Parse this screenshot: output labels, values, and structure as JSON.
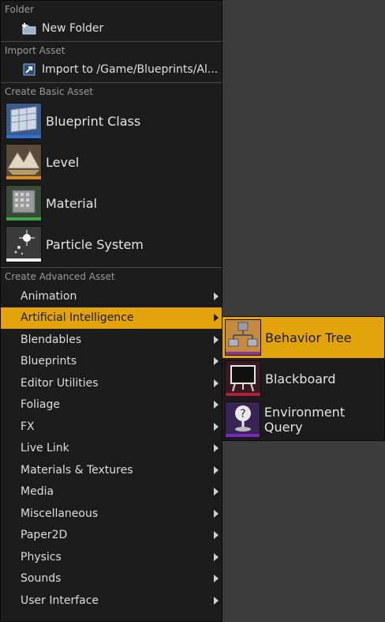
{
  "menu": {
    "folder": {
      "header": "Folder",
      "new_folder": {
        "label": "New Folder",
        "icon": "new-folder-icon"
      }
    },
    "import": {
      "header": "Import Asset",
      "import_item": {
        "label": "Import to /Game/Blueprints/Al...",
        "icon": "import-icon"
      }
    },
    "basic": {
      "header": "Create Basic Asset",
      "items": [
        {
          "label": "Blueprint Class",
          "icon": "blueprint-class-icon",
          "color": "#2f6fd6"
        },
        {
          "label": "Level",
          "icon": "level-icon",
          "color": "#e08a18"
        },
        {
          "label": "Material",
          "icon": "material-icon",
          "color": "#3ca84a"
        },
        {
          "label": "Particle System",
          "icon": "particle-system-icon",
          "color": "#f0f0f0"
        }
      ]
    },
    "advanced": {
      "header": "Create Advanced Asset",
      "items": [
        {
          "label": "Animation"
        },
        {
          "label": "Artificial Intelligence",
          "active": true
        },
        {
          "label": "Blendables"
        },
        {
          "label": "Blueprints"
        },
        {
          "label": "Editor Utilities"
        },
        {
          "label": "Foliage"
        },
        {
          "label": "FX"
        },
        {
          "label": "Live Link"
        },
        {
          "label": "Materials & Textures"
        },
        {
          "label": "Media"
        },
        {
          "label": "Miscellaneous"
        },
        {
          "label": "Paper2D"
        },
        {
          "label": "Physics"
        },
        {
          "label": "Sounds"
        },
        {
          "label": "User Interface"
        }
      ]
    }
  },
  "submenu": {
    "items": [
      {
        "label": "Behavior Tree",
        "icon": "behavior-tree-icon",
        "color": "#8a3a8f",
        "active": true
      },
      {
        "label": "Blackboard",
        "icon": "blackboard-icon",
        "color": "#b01e3a"
      },
      {
        "label": "Environment Query",
        "icon": "environment-query-icon",
        "color": "#7a2ab8"
      }
    ]
  },
  "colors": {
    "accent": "#e2a30b",
    "menu_bg": "#1c1c1c",
    "background": "#3c3c3c"
  }
}
